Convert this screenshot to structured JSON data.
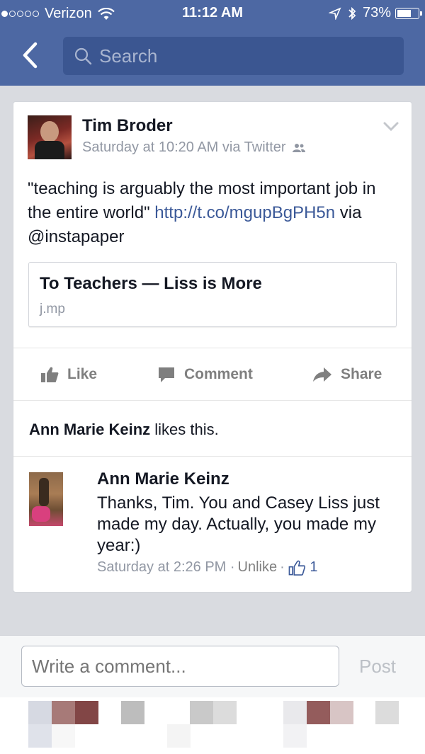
{
  "status_bar": {
    "carrier": "Verizon",
    "time": "11:12 AM",
    "battery": "73%",
    "battery_level": 0.73
  },
  "header": {
    "search_placeholder": "Search",
    "back_icon": "chevron-left-icon",
    "search_icon": "search-icon"
  },
  "post": {
    "author": "Tim Broder",
    "meta": "Saturday at 10:20 AM via Twitter",
    "text_quote": "\"teaching is arguably the most important job in the entire world\" ",
    "text_link": "http://t.co/mgupBgPH5n",
    "text_suffix": " via @instapaper",
    "link_preview": {
      "title": "To Teachers — Liss is More",
      "domain": "j.mp"
    },
    "actions": {
      "like": "Like",
      "comment": "Comment",
      "share": "Share"
    },
    "likes_name": "Ann Marie Keinz",
    "likes_suffix": " likes this."
  },
  "comment": {
    "author": "Ann Marie Keinz",
    "text": "Thanks, Tim. You and Casey Liss just made my day. Actually, you made my year:)",
    "time": "Saturday at 2:26 PM",
    "unlike": "Unlike",
    "like_count": "1"
  },
  "composer": {
    "placeholder": "Write a comment...",
    "post_label": "Post"
  },
  "colors": {
    "header_bg": "#4d68a3",
    "link": "#3b5998",
    "page_bg": "#d9dbe0"
  }
}
